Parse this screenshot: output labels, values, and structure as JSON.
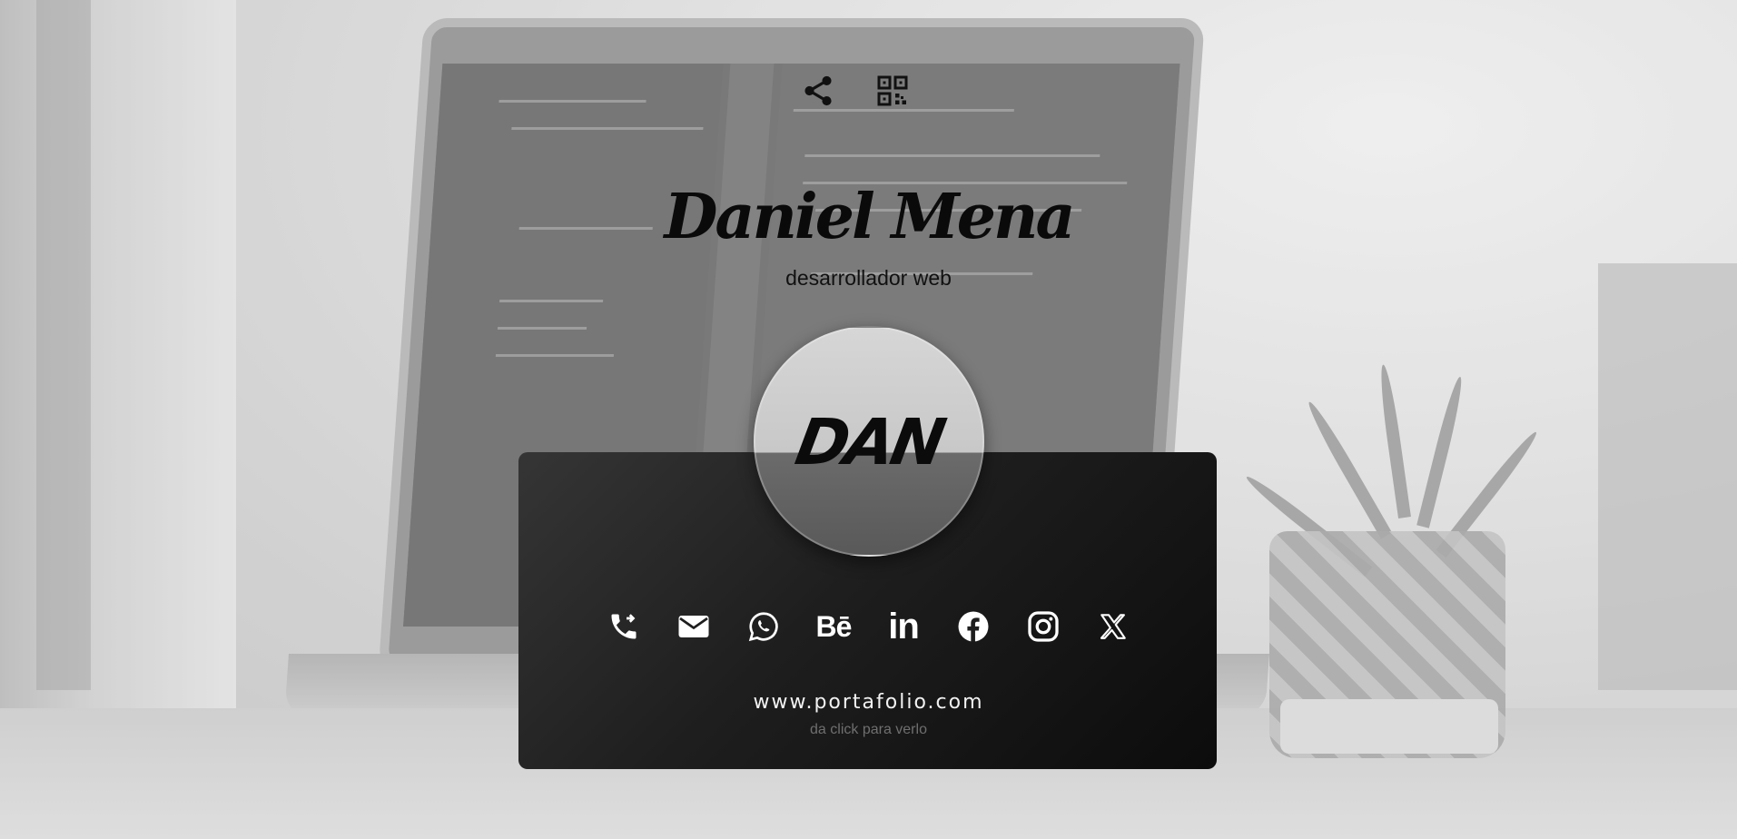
{
  "header": {
    "name": "Daniel Mena",
    "role": "desarrollador web"
  },
  "top_actions": [
    {
      "icon": "share-icon"
    },
    {
      "icon": "qr-code-icon"
    }
  ],
  "avatar": {
    "logo_text": "DAN"
  },
  "socials": [
    {
      "icon": "phone-forward-icon"
    },
    {
      "icon": "email-icon"
    },
    {
      "icon": "whatsapp-icon"
    },
    {
      "icon": "behance-icon",
      "glyph": "Bē"
    },
    {
      "icon": "linkedin-icon",
      "glyph": "in"
    },
    {
      "icon": "facebook-icon"
    },
    {
      "icon": "instagram-icon"
    },
    {
      "icon": "x-twitter-icon"
    }
  ],
  "website": {
    "url": "www.portafolio.com",
    "hint": "da click para verlo"
  },
  "colors": {
    "card_dark": "#0c0c0c",
    "card_light": "#353535",
    "text_light": "#f2f2f2",
    "hint": "#6f6f6f"
  }
}
